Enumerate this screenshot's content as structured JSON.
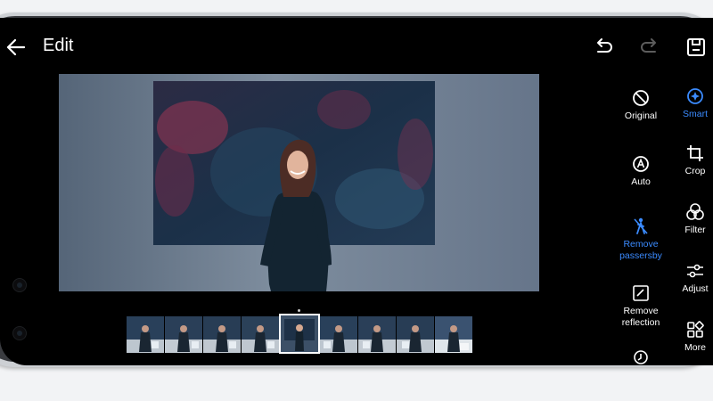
{
  "header": {
    "title": "Edit",
    "back_icon": "back-arrow-icon",
    "undo_icon": "undo-icon",
    "redo_icon": "redo-icon",
    "save_icon": "save-icon"
  },
  "tools": [
    {
      "id": "original",
      "label": "Original",
      "icon": "circle-slash-icon",
      "active": false
    },
    {
      "id": "smart",
      "label": "Smart",
      "icon": "smart-icon",
      "active": true
    },
    {
      "id": "auto",
      "label": "Auto",
      "icon": "auto-icon",
      "active": false
    },
    {
      "id": "crop",
      "label": "Crop",
      "icon": "crop-icon",
      "active": false
    },
    {
      "id": "remove-passersby",
      "label": "Remove passersby",
      "icon": "person-remove-icon",
      "active": true
    },
    {
      "id": "filter",
      "label": "Filter",
      "icon": "filter-icon",
      "active": false
    },
    {
      "id": "adjust",
      "label": "Adjust",
      "icon": "sliders-icon",
      "active": false
    },
    {
      "id": "remove-reflection",
      "label": "Remove reflection",
      "icon": "reflection-icon",
      "active": false
    },
    {
      "id": "more",
      "label": "More",
      "icon": "grid-more-icon",
      "active": false
    }
  ],
  "filmstrip": {
    "frame_count": 9,
    "selected_index": 4
  },
  "colors": {
    "accent": "#3b8bff",
    "background": "#000000",
    "text": "#ffffff"
  }
}
